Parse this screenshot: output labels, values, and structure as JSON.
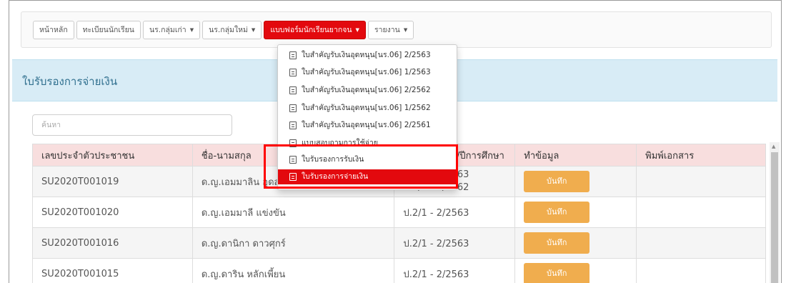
{
  "nav": {
    "items": [
      {
        "label": "หน้าหลัก",
        "dropdown": false
      },
      {
        "label": "ทะเบียนนักเรียน",
        "dropdown": false
      },
      {
        "label": "นร.กลุ่มเก่า",
        "dropdown": true
      },
      {
        "label": "นร.กลุ่มใหม่",
        "dropdown": true
      },
      {
        "label": "แบบฟอร์มนักเรียนยากจน",
        "dropdown": true,
        "active": true
      },
      {
        "label": "รายงาน",
        "dropdown": true
      }
    ]
  },
  "panel": {
    "title": "ใบรับรองการจ่ายเงิน"
  },
  "search": {
    "placeholder": "ค้นหา"
  },
  "table": {
    "headers": [
      "เลขประจำตัวประชาชน",
      "ชื่อ-นามสกุล",
      "ชั้น/ภาคเรียน/ปีการศึกษา",
      "ทำข้อมูล",
      "พิมพ์เอกสาร"
    ],
    "rows": [
      {
        "id": "SU2020T001019",
        "name": "ด.ญ.เอมมาลิน อุดสาห์",
        "class_line1": "ป.2/1 - 2/2563",
        "class_line2": "ป.1/1 - 2/2562",
        "action": "บันทึก"
      },
      {
        "id": "SU2020T001020",
        "name": "ด.ญ.เอมมาลี แข่งขัน",
        "class_line1": "ป.2/1 - 2/2563",
        "action": "บันทึก"
      },
      {
        "id": "SU2020T001016",
        "name": "ด.ญ.ดานิกา ดาวศุกร์",
        "class_line1": "ป.2/1 - 2/2563",
        "action": "บันทึก"
      },
      {
        "id": "SU2020T001015",
        "name": "ด.ญ.ดาริน หลักเพี้ยน",
        "class_line1": "ป.2/1 - 2/2563",
        "action": "บันทึก"
      }
    ]
  },
  "dropdown": {
    "items": [
      "ใบสำคัญรับเงินอุดหนุน[นร.06] 2/2563",
      "ใบสำคัญรับเงินอุดหนุน[นร.06] 1/2563",
      "ใบสำคัญรับเงินอุดหนุน[นร.06] 2/2562",
      "ใบสำคัญรับเงินอุดหนุน[นร.06] 1/2562",
      "ใบสำคัญรับเงินอุดหนุน[นร.06] 2/2561",
      "แบบสอบถามการใช้จ่าย",
      "ใบรับรองการรับเงิน",
      "ใบรับรองการจ่ายเงิน"
    ],
    "selected_index": 7
  },
  "colors": {
    "active": "#e3090e",
    "save": "#f0ad4e",
    "panel": "#d8ecf6",
    "header": "#f8dede",
    "highlight": "#ff0000"
  }
}
